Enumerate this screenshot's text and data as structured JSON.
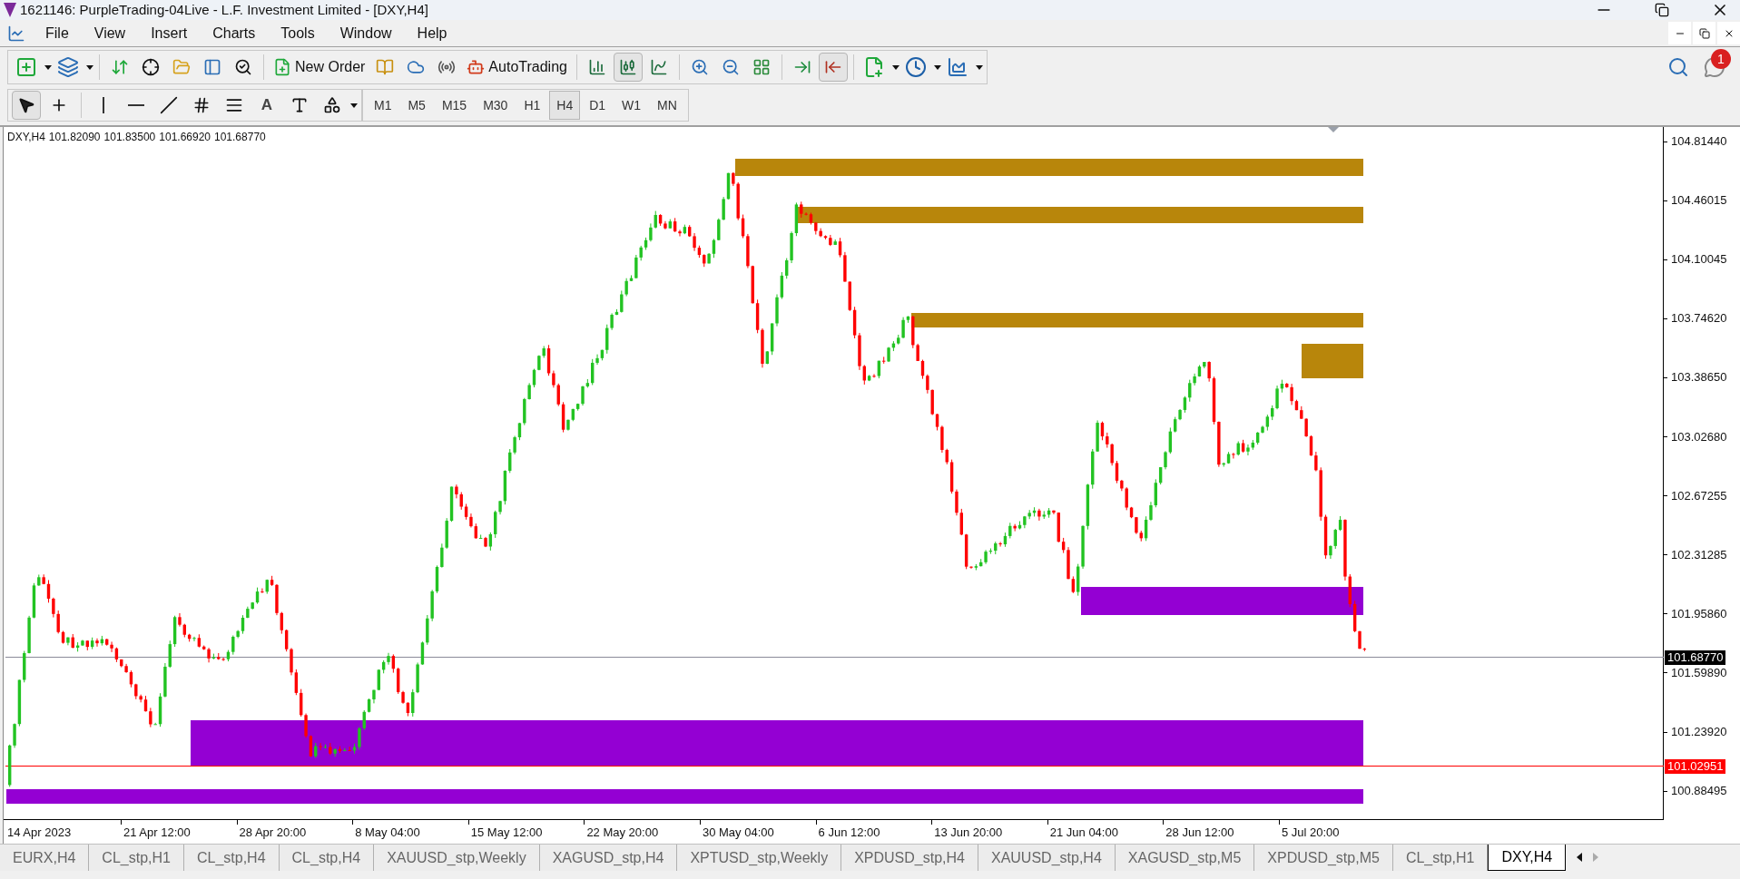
{
  "window": {
    "title": "1621146: PurpleTrading-04Live - L.F. Investment Limited - [DXY,H4]"
  },
  "menu": [
    "File",
    "View",
    "Insert",
    "Charts",
    "Tools",
    "Window",
    "Help"
  ],
  "toolbar": {
    "new_order": "New Order",
    "auto_trading": "AutoTrading",
    "chart_type_buttons": [
      {
        "selected": false
      },
      {
        "selected": true
      },
      {
        "selected": false
      }
    ],
    "scroll_buttons": [
      {
        "selected": false
      },
      {
        "selected": true
      }
    ]
  },
  "notifications": {
    "count": "1"
  },
  "drawing_tools": [
    {
      "selected": true
    },
    {
      "selected": false
    },
    {
      "selected": false
    },
    {
      "selected": false
    },
    {
      "selected": false
    },
    {
      "selected": false
    },
    {
      "selected": false
    },
    {
      "selected": false,
      "label": "A"
    },
    {
      "selected": false
    },
    {
      "selected": false
    }
  ],
  "periods": [
    {
      "label": "M1",
      "selected": false
    },
    {
      "label": "M5",
      "selected": false
    },
    {
      "label": "M15",
      "selected": false
    },
    {
      "label": "M30",
      "selected": false
    },
    {
      "label": "H1",
      "selected": false
    },
    {
      "label": "H4",
      "selected": true
    },
    {
      "label": "D1",
      "selected": false
    },
    {
      "label": "W1",
      "selected": false
    },
    {
      "label": "MN",
      "selected": false
    }
  ],
  "chart": {
    "symbol": "DXY,H4",
    "ohlc": [
      "101.82090",
      "101.83500",
      "101.66920",
      "101.68770"
    ],
    "price_axis": [
      "104.81440",
      "104.46015",
      "104.10045",
      "103.74620",
      "103.38650",
      "103.02680",
      "102.67255",
      "102.31285",
      "101.95860",
      "101.59890",
      "101.23920",
      "100.88495"
    ],
    "price_markers": [
      {
        "kind": "bid",
        "label": "101.68770"
      },
      {
        "kind": "alert",
        "label": "101.02951"
      }
    ],
    "time_axis": [
      "14 Apr 2023",
      "21 Apr 12:00",
      "28 Apr 20:00",
      "8 May 04:00",
      "15 May 12:00",
      "22 May 20:00",
      "30 May 04:00",
      "6 Jun 12:00",
      "13 Jun 20:00",
      "21 Jun 04:00",
      "28 Jun 12:00",
      "5 Jul 20:00"
    ]
  },
  "chart_tabs": [
    {
      "label": "EURX,H4",
      "selected": false
    },
    {
      "label": "CL_stp,H1",
      "selected": false
    },
    {
      "label": "CL_stp,H4",
      "selected": false
    },
    {
      "label": "CL_stp,H4",
      "selected": false
    },
    {
      "label": "XAUUSD_stp,Weekly",
      "selected": false
    },
    {
      "label": "XAGUSD_stp,H4",
      "selected": false
    },
    {
      "label": "XPTUSD_stp,Weekly",
      "selected": false
    },
    {
      "label": "XPDUSD_stp,H4",
      "selected": false
    },
    {
      "label": "XAUUSD_stp,H4",
      "selected": false
    },
    {
      "label": "XAGUSD_stp,M5",
      "selected": false
    },
    {
      "label": "XPDUSD_stp,M5",
      "selected": false
    },
    {
      "label": "CL_stp,H1",
      "selected": false
    },
    {
      "label": "DXY,H4",
      "selected": true
    }
  ]
}
